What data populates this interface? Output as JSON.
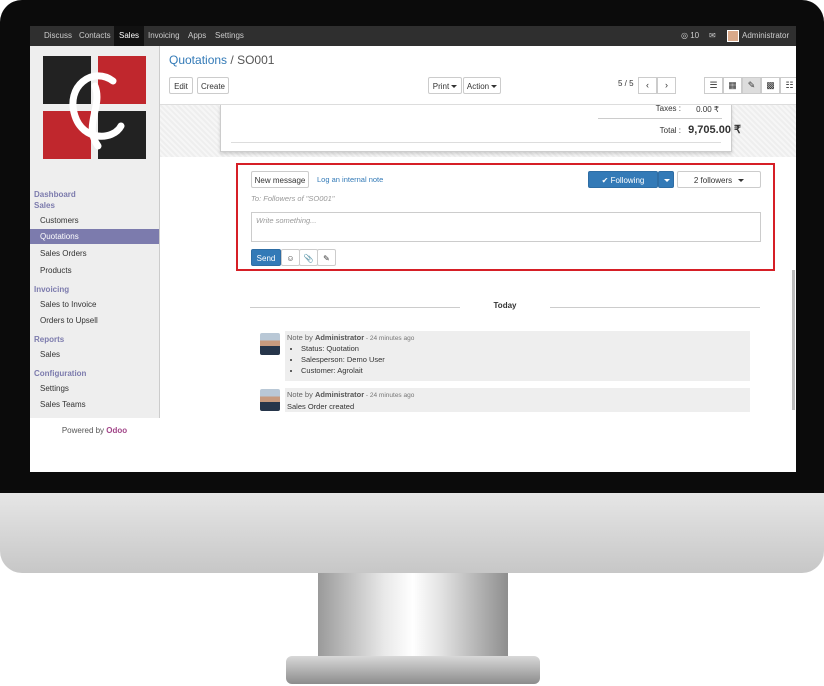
{
  "topbar": {
    "menus": [
      "Discuss",
      "Contacts",
      "Sales",
      "Invoicing",
      "Apps",
      "Settings"
    ],
    "active_menu": "Sales",
    "messages_count": "10",
    "user": "Administrator"
  },
  "sidebar": {
    "sections": [
      {
        "title": "Dashboard",
        "items": []
      },
      {
        "title": "Sales",
        "items": [
          "Customers",
          "Quotations",
          "Sales Orders",
          "Products"
        ]
      },
      {
        "title": "Invoicing",
        "items": [
          "Sales to Invoice",
          "Orders to Upsell"
        ]
      },
      {
        "title": "Reports",
        "items": [
          "Sales"
        ]
      },
      {
        "title": "Configuration",
        "items": [
          "Settings",
          "Sales Teams"
        ]
      }
    ],
    "active_item": "Quotations",
    "powered_prefix": "Powered by ",
    "powered_brand": "Odoo"
  },
  "control_panel": {
    "breadcrumb_parent": "Quotations",
    "breadcrumb_sep": "/",
    "breadcrumb_current": "SO001",
    "edit_label": "Edit",
    "create_label": "Create",
    "print_label": "Print",
    "action_label": "Action",
    "pager": "5 / 5"
  },
  "sheet": {
    "taxes_label": "Taxes :",
    "taxes_value": "0.00 ₹",
    "total_label": "Total :",
    "total_value": "9,705.00 ₹"
  },
  "chatter": {
    "new_message_label": "New message",
    "log_note_label": "Log an internal note",
    "following_label": "Following",
    "followers_label": "2 followers",
    "to_followers": "To: Followers of \"SO001\"",
    "composer_placeholder": "Write something...",
    "send_label": "Send"
  },
  "thread": {
    "date_separator": "Today",
    "messages": [
      {
        "prefix": "Note by ",
        "author": "Administrator",
        "time": " - 24 minutes ago",
        "lines": [
          "Status: Quotation",
          "Salesperson: Demo User",
          "Customer: Agrolait"
        ]
      },
      {
        "prefix": "Note by ",
        "author": "Administrator",
        "time": " - 24 minutes ago",
        "body": "Sales Order created"
      }
    ]
  },
  "colors": {
    "brand_purple": "#7c7bad",
    "primary_blue": "#337ab7",
    "highlight_red": "#d61f26",
    "logo_red": "#c0272d"
  }
}
